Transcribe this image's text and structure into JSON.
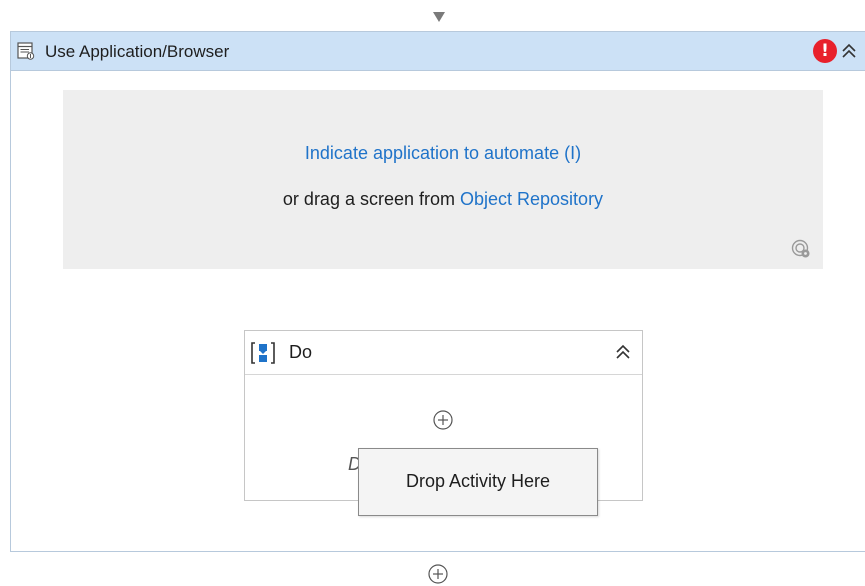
{
  "activity": {
    "title": "Use Application/Browser",
    "error_symbol": "!",
    "icons": {
      "app": "application-window-icon",
      "error": "error-icon",
      "collapse": "double-chevron-up-icon"
    }
  },
  "target": {
    "indicate_label": "Indicate application to automate (I)",
    "drag_prefix": "or drag a screen from ",
    "repository_link": "Object Repository",
    "icon": "target-settings-icon"
  },
  "do_container": {
    "title": "Do",
    "drop_hint": "Drop Activity Here",
    "icons": {
      "sequence": "sequence-icon",
      "collapse": "double-chevron-up-icon",
      "add": "add-activity-icon"
    }
  },
  "tooltip": {
    "text": "Drop Activity Here"
  },
  "colors": {
    "header_bg": "#cce1f6",
    "link": "#1f73c9",
    "error": "#e8202b",
    "target_bg": "#eeeeee"
  }
}
